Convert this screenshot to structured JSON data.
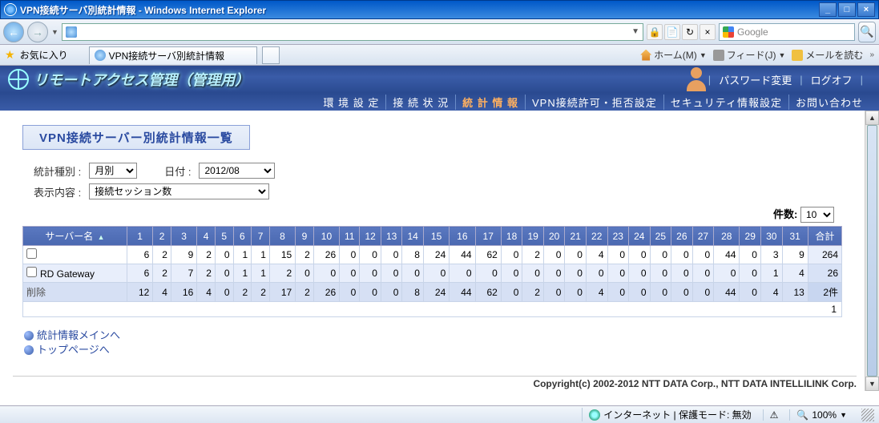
{
  "ie": {
    "title": "VPN接続サーバ別統計情報 - Windows Internet Explorer",
    "address_placeholder": "",
    "search_placeholder": "Google",
    "win_min": "_",
    "win_max": "□",
    "win_close": "×",
    "lock_icon": "🔒",
    "refresh_icon": "↻",
    "stop_icon": "×",
    "search_icon": "🔍",
    "fav_label": "お気に入り",
    "tab_title": "VPN接続サーバ別統計情報",
    "home_label": "ホーム(M)",
    "feed_label": "フィード(J)",
    "mail_label": "メールを読む",
    "dd": "▼",
    "raquo": "»"
  },
  "app": {
    "title": "リモートアクセス管理（管理用）",
    "link_pw": "パスワード変更",
    "link_logoff": "ログオフ",
    "nav": {
      "env": "環 境 設 定",
      "conn": "接 続 状 況",
      "stat": "統 計 情 報",
      "vpn": "VPN接続許可・拒否設定",
      "sec": "セキュリティ情報設定",
      "contact": "お問い合わせ"
    }
  },
  "page": {
    "section_title": "VPN接続サーバー別統計情報一覧",
    "filter": {
      "type_label": "統計種別 :",
      "type_value": "月別",
      "date_label": "日付 :",
      "date_value": "2012/08",
      "content_label": "表示内容 :",
      "content_value": "接続セッション数"
    },
    "kensuu_label": "件数:",
    "kensuu_value": "10",
    "table": {
      "server_header": "サーバー名",
      "sort_icon": "▲",
      "days": [
        "1",
        "2",
        "3",
        "4",
        "5",
        "6",
        "7",
        "8",
        "9",
        "10",
        "11",
        "12",
        "13",
        "14",
        "15",
        "16",
        "17",
        "18",
        "19",
        "20",
        "21",
        "22",
        "23",
        "24",
        "25",
        "26",
        "27",
        "28",
        "29",
        "30",
        "31"
      ],
      "sum_header": "合計",
      "rows": [
        {
          "name": "",
          "checkbox": true,
          "vals": [
            6,
            2,
            9,
            2,
            0,
            1,
            1,
            15,
            2,
            26,
            0,
            0,
            0,
            8,
            24,
            44,
            62,
            0,
            2,
            0,
            0,
            4,
            0,
            0,
            0,
            0,
            0,
            44,
            0,
            3,
            9
          ],
          "sum": 264
        },
        {
          "name": "RD Gateway",
          "checkbox": true,
          "vals": [
            6,
            2,
            7,
            2,
            0,
            1,
            1,
            2,
            0,
            0,
            0,
            0,
            0,
            0,
            0,
            0,
            0,
            0,
            0,
            0,
            0,
            0,
            0,
            0,
            0,
            0,
            0,
            0,
            0,
            1,
            4
          ],
          "sum": 26
        }
      ],
      "total_label": "削除",
      "total_vals": [
        12,
        4,
        16,
        4,
        0,
        2,
        2,
        17,
        2,
        26,
        0,
        0,
        0,
        8,
        24,
        44,
        62,
        0,
        2,
        0,
        0,
        4,
        0,
        0,
        0,
        0,
        0,
        44,
        0,
        4,
        13
      ],
      "total_sum": "2件",
      "foot_count": "1"
    },
    "link_stat_main": "統計情報メインへ",
    "link_top": "トップページへ",
    "copyright": "Copyright(c) 2002-2012 NTT DATA Corp., NTT DATA INTELLILINK Corp."
  },
  "status": {
    "internet": "インターネット | 保護モード: 無効",
    "zoom": "100%",
    "sec_icon": "⚠"
  }
}
